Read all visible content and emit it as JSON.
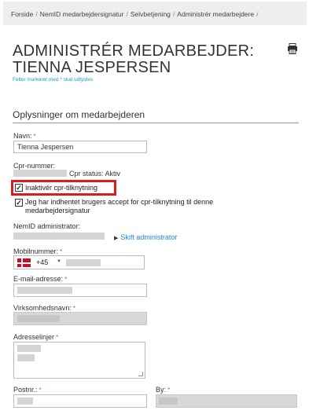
{
  "breadcrumb": [
    "Forside",
    "NemID medarbejdersignatur",
    "Selvbetjening",
    "Administrér medarbejdere",
    ""
  ],
  "page": {
    "title_line1": "ADMINISTRÉR MEDARBEJDER:",
    "title_line2": "TIENNA JESPERSEN",
    "required_note": "Felter markeret med * skal udfyldes",
    "section_title": "Oplysninger om medarbejderen"
  },
  "form": {
    "name_label": "Navn:",
    "name_value": "Tienna Jespersen",
    "cpr_label": "Cpr-nummer:",
    "cpr_status": "Cpr status: Aktiv",
    "deactivate_cpr_label": "Inaktivér cpr-tilknytning",
    "deactivate_cpr_checked": true,
    "accept_label": "Jeg har indhentet brugers accept for cpr-tilknytning til denne medarbejdersignatur",
    "accept_checked": true,
    "nemid_admin_label": "NemID administrator:",
    "change_admin_link": "Skift administrator",
    "mobile_label": "Mobilnummer:",
    "dial_code": "+45",
    "email_label": "E-mail-adresse:",
    "company_label": "Virksomhedsnavn:",
    "address_label": "Adresselinjer",
    "postal_label": "Postnr.:",
    "city_label": "By:",
    "required_star": "*"
  },
  "colors": {
    "accent": "#1a9bd7",
    "highlight": "#e01a1a",
    "link": "#1a8cd0"
  },
  "icons": {
    "print": "printer-icon",
    "flag": "denmark-flag-icon",
    "arrow": "triangle-right-icon"
  }
}
